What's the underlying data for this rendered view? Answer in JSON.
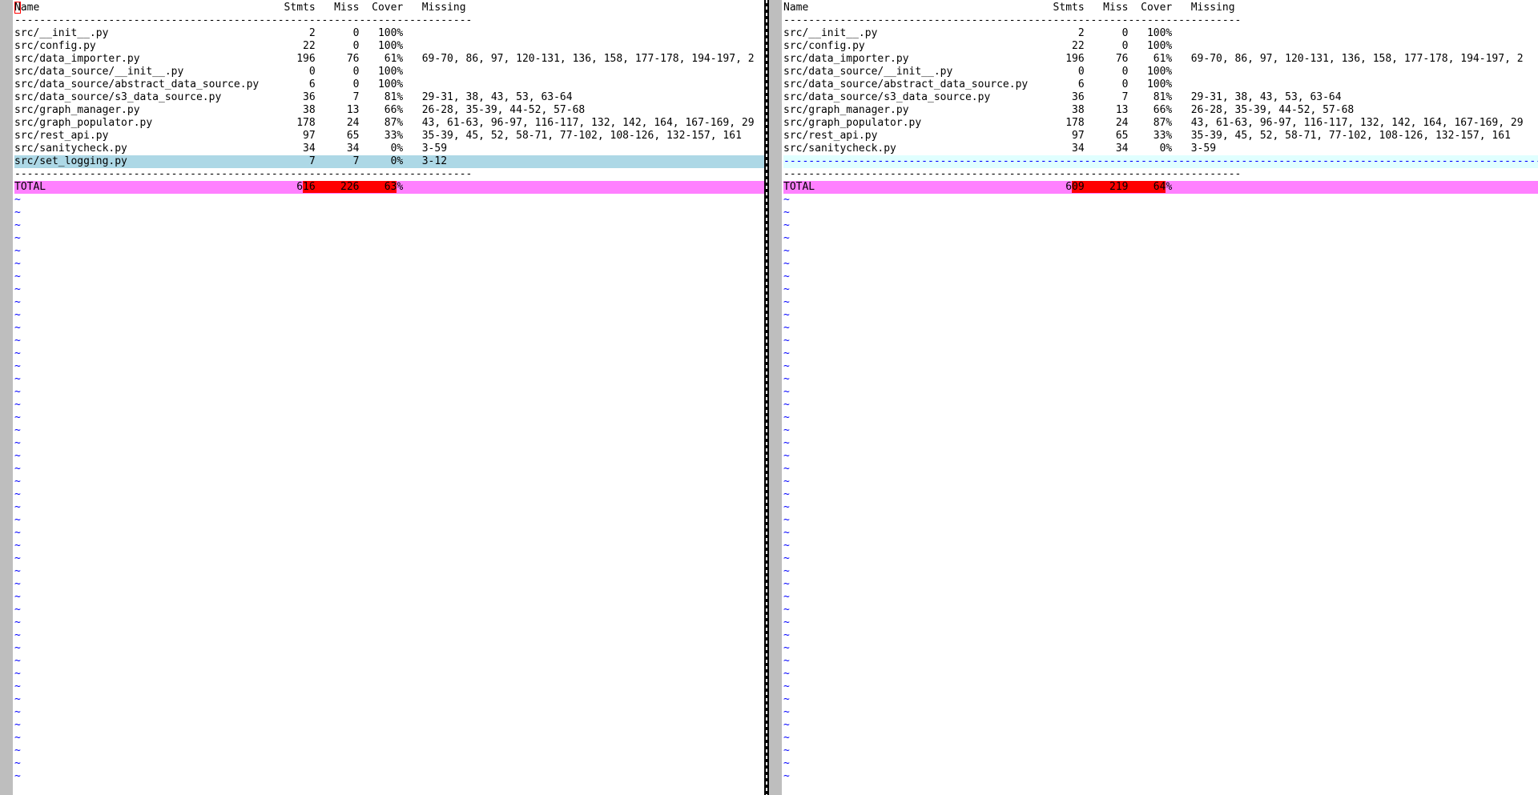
{
  "left": {
    "header": "Name                                       Stmts   Miss  Cover   Missing",
    "header_rest": "ame                                       Stmts   Miss  Cover   Missing",
    "header_first": "N",
    "rule": "-------------------------------------------------------------------------",
    "rows": [
      "src/__init__.py                                2      0   100%",
      "src/config.py                                 22      0   100%",
      "src/data_importer.py                         196     76    61%   69-70, 86, 97, 120-131, 136, 158, 177-178, 194-197, 2",
      "src/data_source/__init__.py                    0      0   100%",
      "src/data_source/abstract_data_source.py        6      0   100%",
      "src/data_source/s3_data_source.py             36      7    81%   29-31, 38, 43, 53, 63-64",
      "src/graph_manager.py                          38     13    66%   26-28, 35-39, 44-52, 57-68",
      "src/graph_populator.py                       178     24    87%   43, 61-63, 96-97, 116-117, 132, 142, 164, 167-169, 29",
      "src/rest_api.py                               97     65    33%   35-39, 45, 52, 58-71, 77-102, 108-126, 132-157, 161",
      "src/sanitycheck.py                            34     34     0%   3-59"
    ],
    "changed_row": "src/set_logging.py                             7      7     0%   3-12",
    "total": {
      "label_pre": "TOTAL                                        6",
      "hl_stmts": "16",
      "gap1": "    ",
      "hl_miss": "226",
      "gap2": "    ",
      "hl_cover": "63",
      "cover_tail": "%"
    }
  },
  "right": {
    "header": "Name                                       Stmts   Miss  Cover   Missing",
    "rule": "-------------------------------------------------------------------------",
    "rows": [
      "src/__init__.py                                2      0   100%",
      "src/config.py                                 22      0   100%",
      "src/data_importer.py                         196     76    61%   69-70, 86, 97, 120-131, 136, 158, 177-178, 194-197, 2",
      "src/data_source/__init__.py                    0      0   100%",
      "src/data_source/abstract_data_source.py        6      0   100%",
      "src/data_source/s3_data_source.py             36      7    81%   29-31, 38, 43, 53, 63-64",
      "src/graph_manager.py                          38     13    66%   26-28, 35-39, 44-52, 57-68",
      "src/graph_populator.py                       178     24    87%   43, 61-63, 96-97, 116-117, 132, 142, 164, 167-169, 29",
      "src/rest_api.py                               97     65    33%   35-39, 45, 52, 58-71, 77-102, 108-126, 132-157, 161",
      "src/sanitycheck.py                            34     34     0%   3-59"
    ],
    "filler_row": "----------------------------------------------------------------------------------------------------------------------------",
    "total": {
      "label_pre": "TOTAL                                        6",
      "hl_stmts": "09",
      "gap1": "    ",
      "hl_miss": "219",
      "gap2": "    ",
      "hl_cover": "64",
      "cover_tail": "%"
    }
  },
  "tilde": "~",
  "colors": {
    "changed_line": "#add8e6",
    "diff_filler": "#e0ffff",
    "diff_text_line": "#ff80ff",
    "diff_text_change": "#ff0000",
    "gutter": "#bebebe",
    "end_of_buffer": "#0000ff"
  }
}
